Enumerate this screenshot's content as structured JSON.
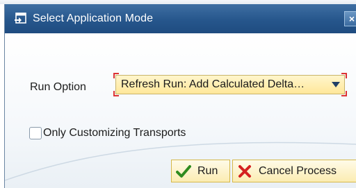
{
  "dialog": {
    "title": "Select Application Mode",
    "title_icon": "window-icon",
    "close_label": "×"
  },
  "form": {
    "run_option_label": "Run Option",
    "run_option_value": "Refresh Run: Add Calculated Delta…",
    "customizing_label": "Only Customizing Transports",
    "customizing_checked": false
  },
  "buttons": {
    "run_label": "Run",
    "run_icon": "checkmark-icon",
    "cancel_label": "Cancel Process",
    "cancel_icon": "cross-icon"
  },
  "colors": {
    "title_bar": "#26568c",
    "field_highlight": "#ffe79a",
    "required_marker": "#dd3333",
    "check_green": "#2e8b1f",
    "cancel_red": "#d42020"
  }
}
